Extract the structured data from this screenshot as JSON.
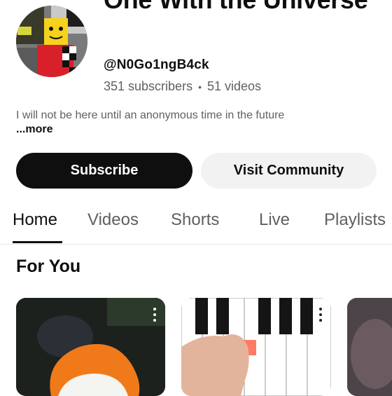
{
  "channel": {
    "title": "One With the Universe",
    "handle": "@N0Go1ngB4ck",
    "subscribers": "351 subscribers",
    "videos": "51 videos",
    "separator": "•",
    "description": "I will not be here until an anonymous time in the future",
    "more_label": "...more"
  },
  "actions": {
    "subscribe_label": "Subscribe",
    "community_label": "Visit Community"
  },
  "tabs": [
    {
      "label": "Home",
      "active": true
    },
    {
      "label": "Videos",
      "active": false
    },
    {
      "label": "Shorts",
      "active": false
    },
    {
      "label": "Live",
      "active": false
    },
    {
      "label": "Playlists",
      "active": false
    }
  ],
  "section": {
    "title": "For You"
  },
  "cards": [
    {
      "icon": "more-vertical-icon"
    },
    {
      "icon": "more-vertical-icon"
    },
    {
      "icon": null
    }
  ]
}
